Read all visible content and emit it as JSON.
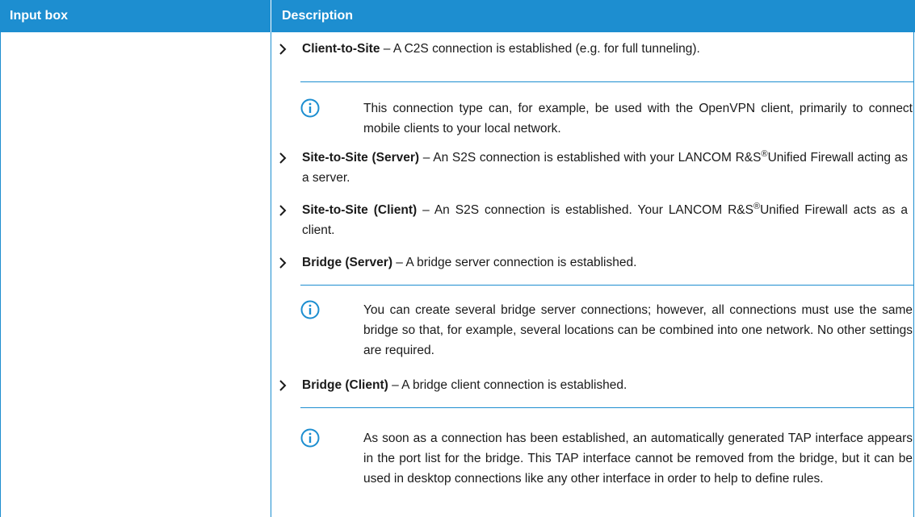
{
  "table": {
    "header": {
      "col1": "Input box",
      "col2": "Description"
    }
  },
  "items": [
    {
      "title": "Client-to-Site",
      "desc": " – A C2S connection is established (e.g. for full tunneling)."
    },
    {
      "title": "Site-to-Site (Server)",
      "desc_pre": " – An S2S connection is established with your LANCOM R&S",
      "sup": "®",
      "desc_post": "Unified Firewall acting as a server."
    },
    {
      "title": "Site-to-Site (Client)",
      "desc_pre": " – An S2S connection is established. Your LANCOM R&S",
      "sup": "®",
      "desc_post": "Unified Firewall acts as a client."
    },
    {
      "title": "Bridge (Server)",
      "desc": " – A bridge server connection is established."
    },
    {
      "title": "Bridge (Client)",
      "desc": " – A bridge client connection is established."
    }
  ],
  "notes": [
    {
      "text": "This connection type can, for example, be used with the OpenVPN client, primarily to connect mobile clients to your local network."
    },
    {
      "text": "You can create several bridge server connections; however, all connections must use the same bridge so that, for example, several locations can be combined into one network. No other settings are required."
    },
    {
      "text": "As soon as a connection has been established, an automatically generated TAP interface appears in the port list for the bridge. This TAP interface cannot be removed from the bridge, but it can be used in desktop connections like any other interface in order to help to define rules."
    }
  ],
  "colors": {
    "accent": "#1d8ed0",
    "text": "#1a1a1a"
  },
  "icons": {
    "bullet": "chevron-right-icon",
    "note": "info-icon"
  }
}
